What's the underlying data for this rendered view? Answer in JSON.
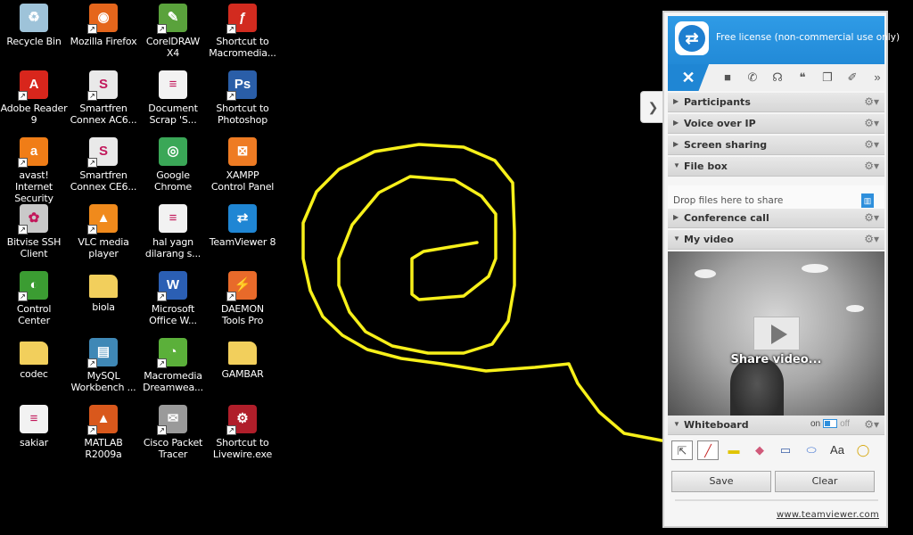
{
  "desktop": {
    "icons": [
      {
        "label": "Recycle Bin",
        "icon": "recycle-bin-icon",
        "color": "#9ec3d9",
        "glyph": "♻",
        "shortcut": false
      },
      {
        "label": "Mozilla Firefox",
        "icon": "firefox-icon",
        "color": "#e5661c",
        "glyph": "◉",
        "shortcut": true
      },
      {
        "label": "CorelDRAW X4",
        "icon": "coreldraw-icon",
        "color": "#5aa23c",
        "glyph": "✎",
        "shortcut": true
      },
      {
        "label": "Shortcut to Macromedia...",
        "icon": "flash-icon",
        "color": "#d22b1f",
        "glyph": "ƒ",
        "shortcut": true
      },
      {
        "label": "Adobe Reader 9",
        "icon": "adobe-reader-icon",
        "color": "#d8261c",
        "glyph": "A",
        "shortcut": true
      },
      {
        "label": "Smartfren Connex AC6...",
        "icon": "smartfren-icon",
        "color": "#e9e9e9",
        "glyph": "S",
        "shortcut": true
      },
      {
        "label": "Document Scrap 'S...",
        "icon": "document-icon",
        "color": "#f2f2f2",
        "glyph": "≡",
        "shortcut": false
      },
      {
        "label": "Shortcut to Photoshop",
        "icon": "photoshop-icon",
        "color": "#2a5ea8",
        "glyph": "Ps",
        "shortcut": true
      },
      {
        "label": "avast! Internet Security",
        "icon": "avast-icon",
        "color": "#f07d17",
        "glyph": "a",
        "shortcut": true
      },
      {
        "label": "Smartfren Connex CE6...",
        "icon": "smartfren-icon",
        "color": "#e9e9e9",
        "glyph": "S",
        "shortcut": true
      },
      {
        "label": "Google Chrome",
        "icon": "chrome-icon",
        "color": "#3aa757",
        "glyph": "◎",
        "shortcut": false
      },
      {
        "label": "XAMPP Control Panel",
        "icon": "xampp-icon",
        "color": "#ee7b23",
        "glyph": "⊠",
        "shortcut": false
      },
      {
        "label": "Bitvise SSH Client",
        "icon": "bitvise-icon",
        "color": "#c9c9c9",
        "glyph": "✿",
        "shortcut": true
      },
      {
        "label": "VLC media player",
        "icon": "vlc-icon",
        "color": "#f08a1c",
        "glyph": "▲",
        "shortcut": true
      },
      {
        "label": "hal yagn dilarang s...",
        "icon": "document-icon",
        "color": "#f2f2f2",
        "glyph": "≡",
        "shortcut": false
      },
      {
        "label": "TeamViewer 8",
        "icon": "teamviewer-icon",
        "color": "#1f86d4",
        "glyph": "⇄",
        "shortcut": false
      },
      {
        "label": "Control Center",
        "icon": "control-center-icon",
        "color": "#3b9c32",
        "glyph": "◐",
        "shortcut": true
      },
      {
        "label": "biola",
        "icon": "folder-icon",
        "color": "#f2cf5c",
        "glyph": "",
        "shortcut": false
      },
      {
        "label": "Microsoft Office W...",
        "icon": "word-icon",
        "color": "#2b5fb4",
        "glyph": "W",
        "shortcut": true
      },
      {
        "label": "DAEMON Tools Pro",
        "icon": "daemon-tools-icon",
        "color": "#e86a2a",
        "glyph": "⚡",
        "shortcut": true
      },
      {
        "label": "codec",
        "icon": "folder-icon",
        "color": "#f2cf5c",
        "glyph": "",
        "shortcut": false
      },
      {
        "label": "MySQL Workbench ...",
        "icon": "mysql-workbench-icon",
        "color": "#3f88b6",
        "glyph": "▤",
        "shortcut": true
      },
      {
        "label": "Macromedia Dreamwea...",
        "icon": "dreamweaver-icon",
        "color": "#5bb03a",
        "glyph": "◔",
        "shortcut": true
      },
      {
        "label": "GAMBAR",
        "icon": "folder-icon",
        "color": "#f2cf5c",
        "glyph": "",
        "shortcut": false
      },
      {
        "label": "sakiar",
        "icon": "document-icon",
        "color": "#f2f2f2",
        "glyph": "≡",
        "shortcut": false
      },
      {
        "label": "MATLAB R2009a",
        "icon": "matlab-icon",
        "color": "#d9581c",
        "glyph": "▲",
        "shortcut": true
      },
      {
        "label": "Cisco Packet Tracer",
        "icon": "packet-tracer-icon",
        "color": "#9a9a9a",
        "glyph": "✉",
        "shortcut": true
      },
      {
        "label": "Shortcut to Livewire.exe",
        "icon": "livewire-icon",
        "color": "#b01e2a",
        "glyph": "⚙",
        "shortcut": true
      }
    ]
  },
  "teamviewer": {
    "license": "Free license (non-commercial use only)",
    "close_glyph": "✕",
    "collapse_glyph": "❯",
    "toolbar": [
      "video-icon",
      "phone-icon",
      "headset-icon",
      "chat-icon",
      "files-icon",
      "broom-icon",
      "more-icon"
    ],
    "toolbar_glyphs": [
      "■",
      "✆",
      "☊",
      "❝",
      "❐",
      "✐",
      "»"
    ],
    "sections": {
      "participants": "Participants",
      "voip": "Voice over IP",
      "screen_sharing": "Screen sharing",
      "file_box": "File box",
      "conference_call": "Conference call",
      "my_video": "My video",
      "whiteboard": "Whiteboard"
    },
    "file_box_hint": "Drop files here to share",
    "share_video": "Share video...",
    "whiteboard": {
      "on": "on",
      "off": "off",
      "tools": [
        "pointer-icon",
        "pen-icon",
        "highlighter-icon",
        "eraser-icon",
        "rectangle-icon",
        "ellipse-icon",
        "text-icon",
        "speech-bubble-icon"
      ],
      "tool_glyphs": [
        "⇱",
        "╱",
        "▬",
        "◆",
        "▭",
        "⬭",
        "Aa",
        "◯"
      ],
      "tool_colors": [
        "#555555",
        "#c62828",
        "#e0c400",
        "#d05a7a",
        "#3a5fa8",
        "#3a6fd0",
        "#333333",
        "#d4a300"
      ],
      "save": "Save",
      "clear": "Clear"
    },
    "link": "www.teamviewer.com"
  },
  "colors": {
    "scribble": "#f7f01a",
    "teamviewer_blue": "#1f86d4"
  }
}
